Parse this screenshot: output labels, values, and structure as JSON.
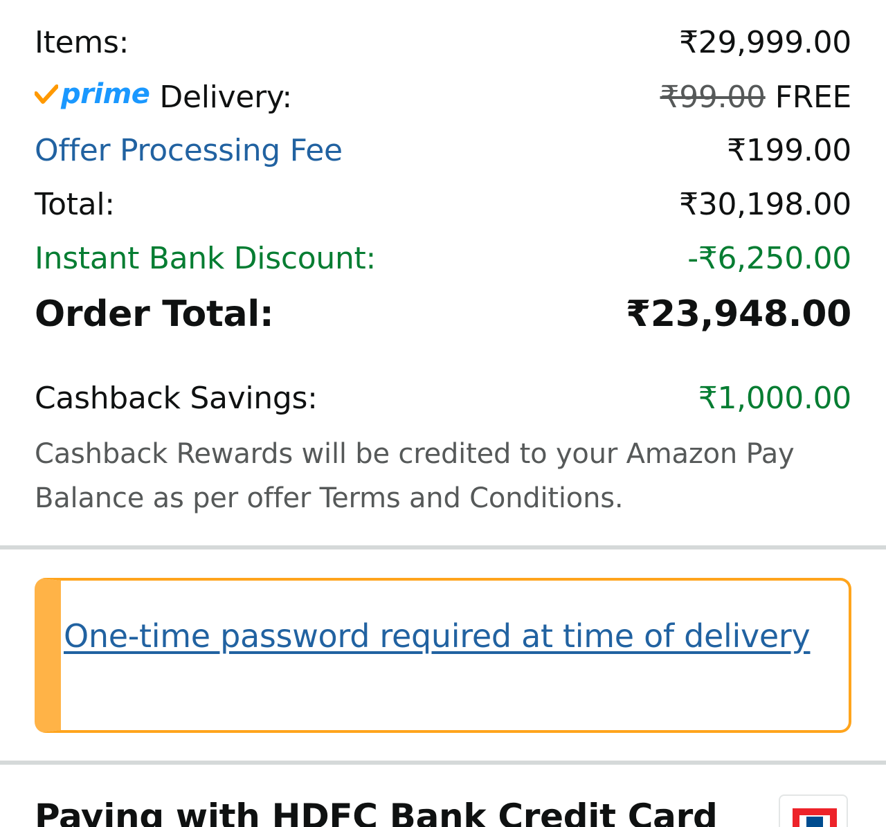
{
  "summary": {
    "items": {
      "label": "Items:",
      "value": "₹29,999.00"
    },
    "delivery": {
      "prime_label": "prime",
      "label": "Delivery:",
      "original": "₹99.00",
      "value": "FREE"
    },
    "fee": {
      "label": "Offer Processing Fee",
      "value": "₹199.00"
    },
    "total": {
      "label": "Total:",
      "value": "₹30,198.00"
    },
    "discount": {
      "label": "Instant Bank Discount:",
      "value": "-₹6,250.00"
    },
    "order_total": {
      "label": "Order Total:",
      "value": "₹23,948.00"
    }
  },
  "cashback": {
    "label": "Cashback Savings:",
    "value": "₹1,000.00",
    "note": "Cashback Rewards will be credited to your Amazon Pay Balance as per offer Terms and Conditions."
  },
  "alert": {
    "link_text": "One-time password required at time of delivery"
  },
  "payment": {
    "title": "Paying with HDFC Bank Credit Card",
    "bank_logo_icon": "hdfc-bank-logo-icon"
  },
  "colors": {
    "link": "#2162a1",
    "green": "#067d32",
    "alert_border": "#ffa41c",
    "prime_blue": "#1a98ff",
    "prime_check": "#ff9900"
  }
}
